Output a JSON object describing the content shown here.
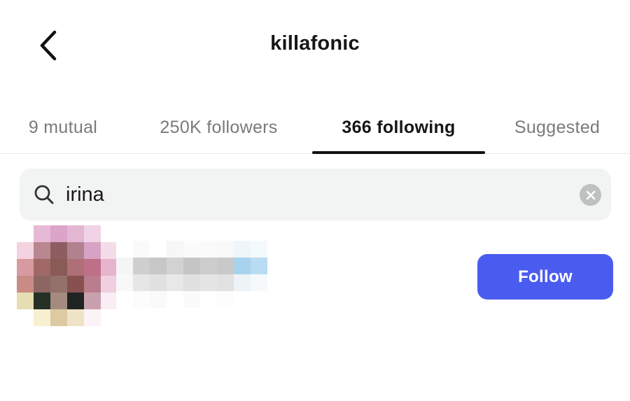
{
  "header": {
    "title": "killafonic",
    "back_icon": "chevron-left-icon"
  },
  "tabs": [
    {
      "label": "9 mutual",
      "active": false
    },
    {
      "label": "250K followers",
      "active": false
    },
    {
      "label": "366 following",
      "active": true
    },
    {
      "label": "Suggested",
      "active": false
    }
  ],
  "search": {
    "value": "irina",
    "search_icon": "search-icon",
    "clear_icon": "clear-icon"
  },
  "results": [
    {
      "avatar": "pixelated-avatar",
      "username": "",
      "follow_label": "Follow"
    }
  ],
  "colors": {
    "accent": "#4a5cf0",
    "search_bg": "#f2f3f3",
    "inactive_tab": "#7a7a7a",
    "active_tab": "#161616"
  }
}
